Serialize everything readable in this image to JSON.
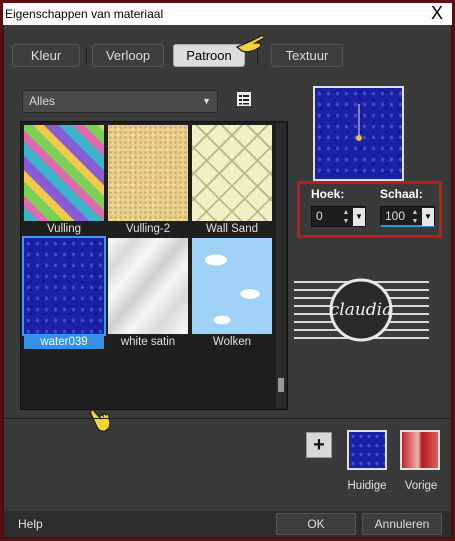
{
  "window": {
    "title": "Eigenschappen van materiaal",
    "close_glyph": "X"
  },
  "tabs": [
    {
      "label": "Kleur",
      "active": false
    },
    {
      "label": "Verloop",
      "active": false
    },
    {
      "label": "Patroon",
      "active": true
    },
    {
      "label": "Textuur",
      "active": false
    }
  ],
  "category": {
    "selected": "Alles"
  },
  "patterns": [
    {
      "name": "Vulling",
      "selected": false
    },
    {
      "name": "Vulling-2",
      "selected": false
    },
    {
      "name": "Wall Sand",
      "selected": false
    },
    {
      "name": "water039",
      "selected": true
    },
    {
      "name": "white satin",
      "selected": false
    },
    {
      "name": "Wolken",
      "selected": false
    }
  ],
  "settings": {
    "angle_label": "Hoek:",
    "angle_value": "0",
    "scale_label": "Schaal:",
    "scale_value": "100"
  },
  "swatches": {
    "current_label": "Huidige",
    "previous_label": "Vorige"
  },
  "footer": {
    "help": "Help",
    "ok": "OK",
    "cancel": "Annuleren"
  },
  "watermark": {
    "text": "claudia"
  },
  "colors": {
    "accent": "#3392e8",
    "highlight_border": "#c81818"
  }
}
